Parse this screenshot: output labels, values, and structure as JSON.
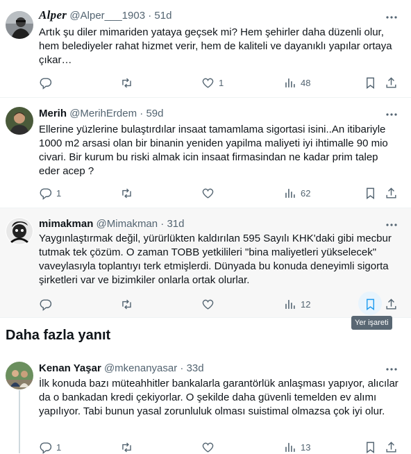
{
  "replies": [
    {
      "name": "Alper",
      "handle": "@Alper___1903",
      "sep": "·",
      "time": "51d",
      "text": "Artık şu diler mimariden yataya geçsek mi? Hem şehirler daha düzenli olur, hem belediyeler rahat hizmet verir, hem de kaliteli ve dayanıklı yapılar ortaya çıkar…",
      "replies": "",
      "reposts": "",
      "likes": "1",
      "views": "48"
    },
    {
      "name": "Merih",
      "handle": "@MerihErdem",
      "sep": "·",
      "time": "59d",
      "text": "Ellerine yüzlerine bulaştırdılar insaat tamamlama sigortasi isini..An itibariyle 1000 m2 arsasi olan bir binanin yeniden yapilma maliyeti iyi ihtimalle 90 mio civari. Bir kurum bu riski almak icin insaat firmasindan ne kadar prim talep eder acep ?",
      "replies": "1",
      "reposts": "",
      "likes": "",
      "views": "62"
    },
    {
      "name": "mimakman",
      "handle": "@Mimakman",
      "sep": "·",
      "time": "31d",
      "text": "Yaygınlaştırmak değil, yürürlükten kaldırılan 595 Sayılı KHK'daki gibi mecbur tutmak tek çözüm. O zaman TOBB yetkilileri \"bina maliyetleri yükselecek\" vaveylasıyla toplantıyı terk etmişlerdi. Dünyada bu konuda deneyimli sigorta şirketleri var ve bizimkiler onlarla ortak olurlar.",
      "replies": "",
      "reposts": "",
      "likes": "",
      "views": "12"
    },
    {
      "name": "Kenan Yaşar",
      "handle": "@mkenanyasar",
      "sep": "·",
      "time": "33d",
      "text": "İlk konuda bazı müteahhitler bankalarla garantörlük anlaşması yapıyor, alıcılar da o bankadan kredi çekiyorlar. O şekilde daha güvenli temelden ev alımı yapılıyor. Tabi bunun yasal zorunluluk olması suistimal olmazsa çok iyi olur.",
      "replies": "1",
      "reposts": "",
      "likes": "",
      "views": "13"
    }
  ],
  "section_title": "Daha fazla yanıt",
  "tooltip": "Yer işareti",
  "colors": {
    "text": "#0f1419",
    "secondary": "#536471",
    "accent": "#1d9bf0",
    "border": "#eff3f4"
  }
}
